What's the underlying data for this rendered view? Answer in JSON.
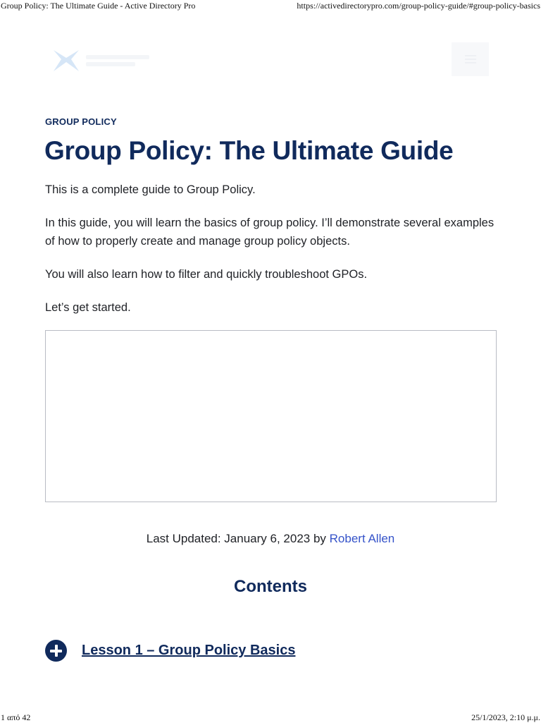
{
  "print": {
    "header_title": "Group Policy: The Ultimate Guide - Active Directory Pro",
    "header_url": "https://activedirectorypro.com/group-policy-guide/#group-policy-basics",
    "footer_page": "1 από 42",
    "footer_datetime": "25/1/2023, 2:10 μ.μ."
  },
  "header": {
    "logo_icon": "active-directory-pro-logo",
    "menu_icon": "hamburger-menu-icon"
  },
  "article": {
    "category": "GROUP POLICY",
    "title": "Group Policy: The Ultimate Guide",
    "intro": [
      "This is a complete guide to Group Policy.",
      "In this guide, you will learn the basics of group policy. I’ll demonstrate several examples of how to properly create and manage group policy objects.",
      "You will also learn how to filter and quickly troubleshoot GPOs.",
      "Let’s get started."
    ],
    "updated_prefix": "Last Updated: January 6, 2023 by ",
    "author": "Robert Allen"
  },
  "toc": {
    "heading": "Contents",
    "lessons": [
      {
        "label": "Lesson 1 – Group Policy Basics",
        "icon": "plus-circle-icon"
      }
    ]
  },
  "colors": {
    "heading": "#102a5c",
    "link": "#3553c9",
    "body_text": "#1f2126"
  }
}
